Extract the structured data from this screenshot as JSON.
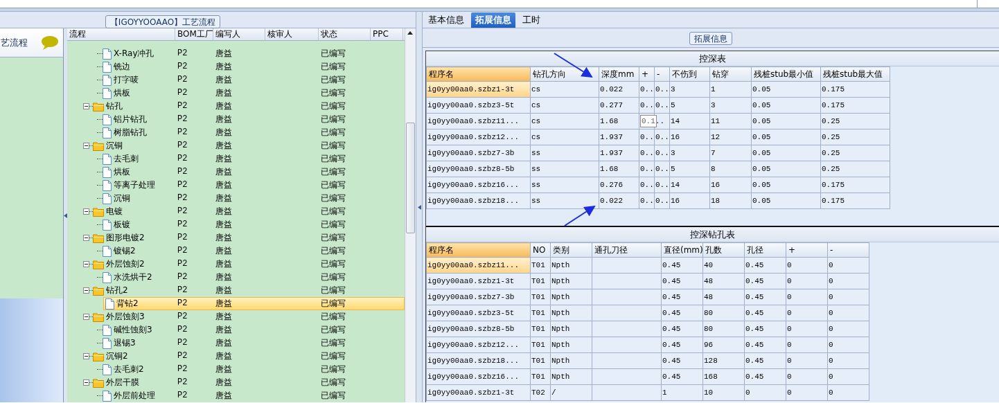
{
  "group_title": "【IGOYYOOAAO】工艺流程",
  "sidebar": {
    "title": "艺流程"
  },
  "process_tree": {
    "columns": [
      "流程",
      "BOM工厂",
      "编写人",
      "核审人",
      "状态",
      "PPC"
    ],
    "nodes": [
      {
        "kind": "hidden",
        "children": [
          {
            "kind": "file",
            "label": "X-Ray冲孔",
            "bom": "P2",
            "author": "唐益",
            "status": "已编写",
            "selected": false
          },
          {
            "kind": "file",
            "label": "铣边",
            "bom": "P2",
            "author": "唐益",
            "status": "已编写",
            "selected": false
          },
          {
            "kind": "file",
            "label": "打字唛",
            "bom": "P2",
            "author": "唐益",
            "status": "已编写",
            "selected": false
          },
          {
            "kind": "file",
            "label": "烘板",
            "bom": "P2",
            "author": "唐益",
            "status": "已编写",
            "selected": false
          }
        ]
      },
      {
        "kind": "folder",
        "label": "钻孔",
        "bom": "P2",
        "author": "唐益",
        "status": "已编写",
        "selected": false,
        "expanded": true,
        "children": [
          {
            "kind": "file",
            "label": "铝片钻孔",
            "bom": "P2",
            "author": "唐益",
            "status": "已编写",
            "selected": false
          },
          {
            "kind": "file",
            "label": "树脂钻孔",
            "bom": "P2",
            "author": "唐益",
            "status": "已编写",
            "selected": false
          }
        ]
      },
      {
        "kind": "folder",
        "label": "沉铜",
        "bom": "P2",
        "author": "唐益",
        "status": "已编写",
        "selected": false,
        "expanded": true,
        "children": [
          {
            "kind": "file",
            "label": "去毛刺",
            "bom": "P2",
            "author": "唐益",
            "status": "已编写",
            "selected": false
          },
          {
            "kind": "file",
            "label": "烘板",
            "bom": "P2",
            "author": "唐益",
            "status": "已编写",
            "selected": false
          },
          {
            "kind": "file",
            "label": "等离子处理",
            "bom": "P2",
            "author": "唐益",
            "status": "已编写",
            "selected": false
          },
          {
            "kind": "file",
            "label": "沉铜",
            "bom": "P2",
            "author": "唐益",
            "status": "已编写",
            "selected": false
          }
        ]
      },
      {
        "kind": "folder",
        "label": "电镀",
        "bom": "P2",
        "author": "唐益",
        "status": "已编写",
        "selected": false,
        "expanded": true,
        "children": [
          {
            "kind": "file",
            "label": "板镀",
            "bom": "P2",
            "author": "唐益",
            "status": "已编写",
            "selected": false
          }
        ]
      },
      {
        "kind": "folder",
        "label": "图形电镀2",
        "bom": "P2",
        "author": "唐益",
        "status": "已编写",
        "selected": false,
        "expanded": true,
        "children": [
          {
            "kind": "file",
            "label": "镀锡2",
            "bom": "P2",
            "author": "唐益",
            "status": "已编写",
            "selected": false
          }
        ]
      },
      {
        "kind": "folder",
        "label": "外层蚀刻2",
        "bom": "P2",
        "author": "唐益",
        "status": "已编写",
        "selected": false,
        "expanded": true,
        "children": [
          {
            "kind": "file",
            "label": "水洗烘干2",
            "bom": "P2",
            "author": "唐益",
            "status": "已编写",
            "selected": false
          }
        ]
      },
      {
        "kind": "folder",
        "label": "钻孔2",
        "bom": "P2",
        "author": "唐益",
        "status": "已编写",
        "selected": false,
        "expanded": true,
        "children": [
          {
            "kind": "file",
            "label": "背钻2",
            "bom": "P2",
            "author": "唐益",
            "status": "已编写",
            "selected": true
          }
        ]
      },
      {
        "kind": "folder",
        "label": "外层蚀刻3",
        "bom": "P2",
        "author": "唐益",
        "status": "已编写",
        "selected": false,
        "expanded": true,
        "children": [
          {
            "kind": "file",
            "label": "碱性蚀刻3",
            "bom": "P2",
            "author": "唐益",
            "status": "已编写",
            "selected": false
          },
          {
            "kind": "file",
            "label": "退锡3",
            "bom": "P2",
            "author": "唐益",
            "status": "已编写",
            "selected": false
          }
        ]
      },
      {
        "kind": "folder",
        "label": "沉铜2",
        "bom": "P2",
        "author": "唐益",
        "status": "已编写",
        "selected": false,
        "expanded": true,
        "children": [
          {
            "kind": "file",
            "label": "去毛刺2",
            "bom": "P2",
            "author": "唐益",
            "status": "已编写",
            "selected": false
          }
        ]
      },
      {
        "kind": "folder",
        "label": "外层干膜",
        "bom": "P2",
        "author": "唐益",
        "status": "已编写",
        "selected": false,
        "expanded": true,
        "children": [
          {
            "kind": "file",
            "label": "外层前处理",
            "bom": "P2",
            "author": "唐益",
            "status": "已编写",
            "selected": false
          }
        ]
      }
    ]
  },
  "tabs": [
    {
      "label": "基本信息",
      "selected": false
    },
    {
      "label": "拓展信息",
      "selected": true
    },
    {
      "label": "工时",
      "selected": false
    }
  ],
  "panel_title": "拓展信息",
  "depth_table": {
    "title": "控深表",
    "columns": [
      {
        "label": "程序名",
        "highlighted": true
      },
      {
        "label": "钻孔方向",
        "highlighted": false
      },
      {
        "label": "深度mm",
        "highlighted": false
      },
      {
        "label": "+",
        "highlighted": false
      },
      {
        "label": "-",
        "highlighted": false
      },
      {
        "label": "不伤到",
        "highlighted": false
      },
      {
        "label": "钻穿",
        "highlighted": false
      },
      {
        "label": "残桩stub最小值",
        "highlighted": false
      },
      {
        "label": "残桩stub最大值",
        "highlighted": false
      }
    ],
    "rows": [
      {
        "selected": true,
        "editing": false,
        "cells": [
          "ig0yy00aa0.szbz1-3t",
          "cs",
          "0.022",
          "0..",
          "0..",
          "3",
          "1",
          "0.05",
          "0.175"
        ]
      },
      {
        "selected": false,
        "editing": false,
        "cells": [
          "ig0yy00aa0.szbz3-5t",
          "cs",
          "0.277",
          "0..",
          "0..",
          "5",
          "3",
          "0.05",
          "0.175"
        ]
      },
      {
        "selected": false,
        "editing": true,
        "cells": [
          "ig0yy00aa0.szbz11...",
          "cs",
          "1.68",
          "0.1",
          "..",
          "14",
          "11",
          "0.05",
          "0.25"
        ]
      },
      {
        "selected": false,
        "editing": false,
        "cells": [
          "ig0yy00aa0.szbz12...",
          "cs",
          "1.937",
          "0..",
          "0..",
          "16",
          "12",
          "0.05",
          "0.25"
        ]
      },
      {
        "selected": false,
        "editing": false,
        "cells": [
          "ig0yy00aa0.szbz7-3b",
          "ss",
          "1.937",
          "0..",
          "0..",
          "3",
          "7",
          "0.05",
          "0.25"
        ]
      },
      {
        "selected": false,
        "editing": false,
        "cells": [
          "ig0yy00aa0.szbz8-5b",
          "ss",
          "1.68",
          "0..",
          "0..",
          "5",
          "8",
          "0.05",
          "0.25"
        ]
      },
      {
        "selected": false,
        "editing": false,
        "cells": [
          "ig0yy00aa0.szbz16...",
          "ss",
          "0.276",
          "0..",
          "0..",
          "14",
          "16",
          "0.05",
          "0.175"
        ]
      },
      {
        "selected": false,
        "editing": false,
        "cells": [
          "ig0yy00aa0.szbz18...",
          "ss",
          "0.022",
          "0..",
          "0..",
          "16",
          "18",
          "0.05",
          "0.175"
        ]
      }
    ]
  },
  "drill_table": {
    "title": "控深钻孔表",
    "columns": [
      {
        "label": "程序名",
        "highlighted": true
      },
      {
        "label": "NO",
        "highlighted": false
      },
      {
        "label": "类别",
        "highlighted": false
      },
      {
        "label": "通孔刀径",
        "highlighted": false
      },
      {
        "label": "直径(mm)",
        "highlighted": false
      },
      {
        "label": "孔数",
        "highlighted": false
      },
      {
        "label": "孔径",
        "highlighted": false
      },
      {
        "label": "+",
        "highlighted": false
      },
      {
        "label": "-",
        "highlighted": false
      }
    ],
    "rows": [
      {
        "selected": true,
        "cells": [
          "ig0yy00aa0.szbz11...",
          "T01",
          "Npth",
          "",
          "0.45",
          "40",
          "0.45",
          "0",
          "0"
        ]
      },
      {
        "selected": false,
        "cells": [
          "ig0yy00aa0.szbz1-3t",
          "T01",
          "Npth",
          "",
          "0.45",
          "48",
          "0.45",
          "0",
          "0"
        ]
      },
      {
        "selected": false,
        "cells": [
          "ig0yy00aa0.szbz7-3b",
          "T01",
          "Npth",
          "",
          "0.45",
          "48",
          "0.45",
          "0",
          "0"
        ]
      },
      {
        "selected": false,
        "cells": [
          "ig0yy00aa0.szbz3-5t",
          "T01",
          "Npth",
          "",
          "0.45",
          "80",
          "0.45",
          "0",
          "0"
        ]
      },
      {
        "selected": false,
        "cells": [
          "ig0yy00aa0.szbz8-5b",
          "T01",
          "Npth",
          "",
          "0.45",
          "80",
          "0.45",
          "0",
          "0"
        ]
      },
      {
        "selected": false,
        "cells": [
          "ig0yy00aa0.szbz12...",
          "T01",
          "Npth",
          "",
          "0.45",
          "96",
          "0.45",
          "0",
          "0"
        ]
      },
      {
        "selected": false,
        "cells": [
          "ig0yy00aa0.szbz18...",
          "T01",
          "Npth",
          "",
          "0.45",
          "128",
          "0.45",
          "0",
          "0"
        ]
      },
      {
        "selected": false,
        "cells": [
          "ig0yy00aa0.szbz16...",
          "T01",
          "Npth",
          "",
          "0.45",
          "168",
          "0.45",
          "0",
          "0"
        ]
      },
      {
        "selected": false,
        "cells": [
          "ig0yy00aa0.szbz1-3t",
          "T02",
          "/",
          "",
          "1",
          "10",
          "0",
          "0",
          "0"
        ]
      }
    ]
  }
}
